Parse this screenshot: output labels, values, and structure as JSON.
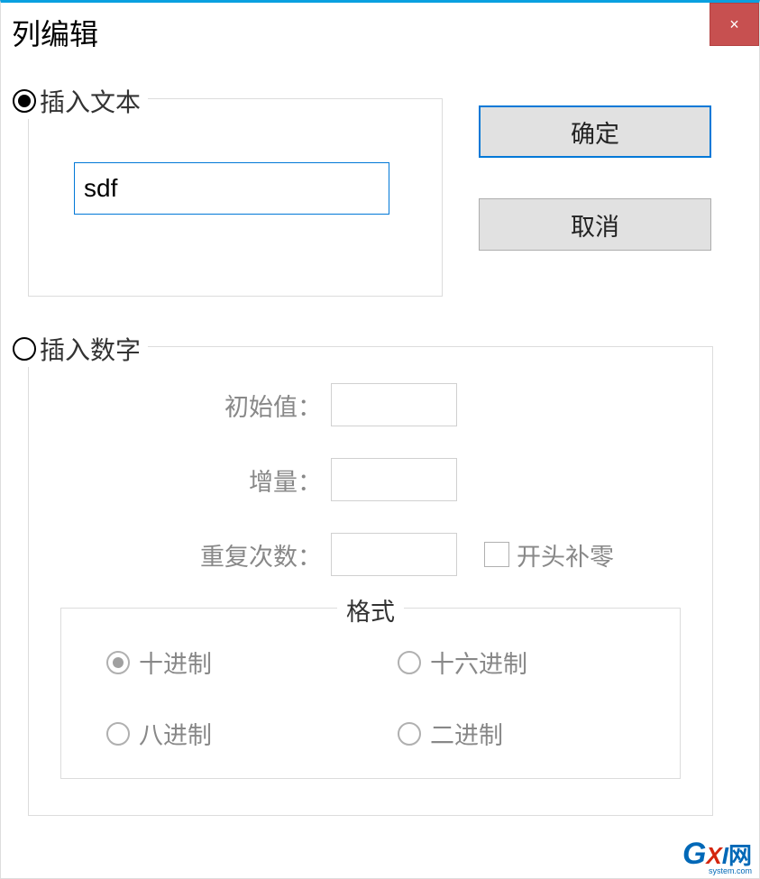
{
  "title": "列编辑",
  "close_symbol": "×",
  "insert_text": {
    "legend": "插入文本",
    "value": "sdf"
  },
  "buttons": {
    "ok": "确定",
    "cancel": "取消"
  },
  "insert_number": {
    "legend": "插入数字",
    "initial_label": "初始值：",
    "initial_value": "",
    "increment_label": "增量：",
    "increment_value": "",
    "repeat_label": "重复次数：",
    "repeat_value": "",
    "pad_zero_label": "开头补零"
  },
  "format": {
    "legend": "格式",
    "dec": "十进制",
    "hex": "十六进制",
    "oct": "八进制",
    "bin": "二进制"
  },
  "watermark": {
    "g": "G",
    "x": "X",
    "i": "I",
    "cn": "网",
    "sub": "system.com"
  }
}
